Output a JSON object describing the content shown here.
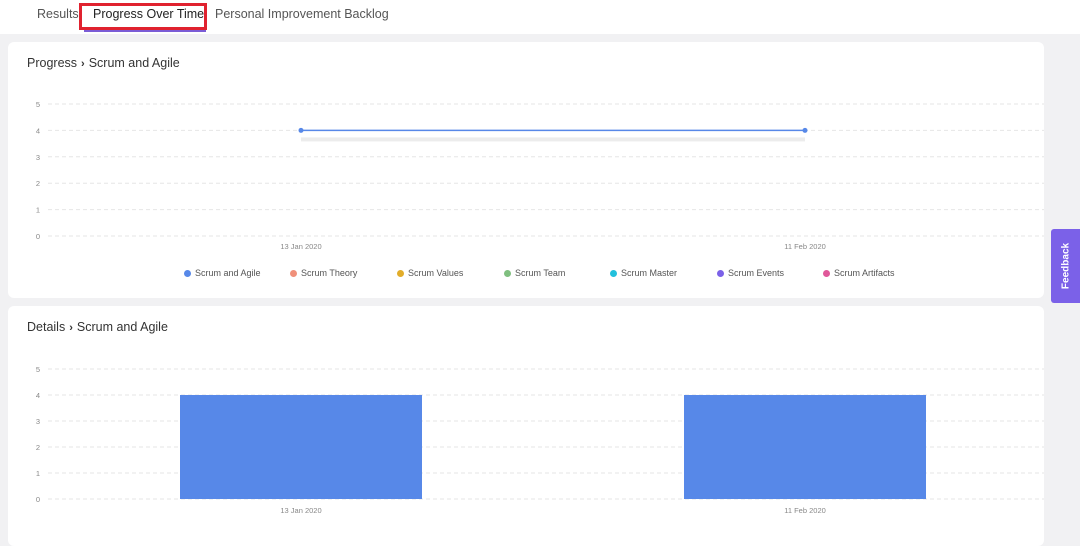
{
  "tabs": [
    {
      "label": "Results",
      "active": false
    },
    {
      "label": "Progress Over Time",
      "active": true
    },
    {
      "label": "Personal Improvement Backlog",
      "active": false
    }
  ],
  "progress_card": {
    "section": "Progress",
    "topic": "Scrum and Agile"
  },
  "details_card": {
    "section": "Details",
    "topic": "Scrum and Agile"
  },
  "feedback_label": "Feedback",
  "colors": {
    "accent": "#7b61e8",
    "primary_series": "#5788e8",
    "highlight": "#e0222f"
  },
  "chart_data": [
    {
      "type": "line",
      "title": "Progress > Scrum and Agile",
      "x": [
        "13 Jan 2020",
        "11 Feb 2020"
      ],
      "ylim": [
        0,
        5
      ],
      "yticks": [
        "0",
        "1",
        "2",
        "3",
        "4",
        "5"
      ],
      "grid": true,
      "legend_position": "bottom",
      "series": [
        {
          "name": "Scrum and Agile",
          "color": "#5788e8",
          "values": [
            4,
            4
          ]
        },
        {
          "name": "Scrum Theory",
          "color": "#f0907a",
          "values": []
        },
        {
          "name": "Scrum Values",
          "color": "#e2ad2a",
          "values": []
        },
        {
          "name": "Scrum Team",
          "color": "#7fbf7f",
          "values": []
        },
        {
          "name": "Scrum Master",
          "color": "#22c0dc",
          "values": []
        },
        {
          "name": "Scrum Events",
          "color": "#7b61e8",
          "values": []
        },
        {
          "name": "Scrum Artifacts",
          "color": "#e0589a",
          "values": []
        }
      ]
    },
    {
      "type": "bar",
      "title": "Details > Scrum and Agile",
      "categories": [
        "13 Jan 2020",
        "11 Feb 2020"
      ],
      "values": [
        4,
        4
      ],
      "color": "#5788e8",
      "ylim": [
        0,
        5
      ],
      "yticks": [
        "0",
        "1",
        "2",
        "3",
        "4",
        "5"
      ],
      "grid": true
    }
  ]
}
